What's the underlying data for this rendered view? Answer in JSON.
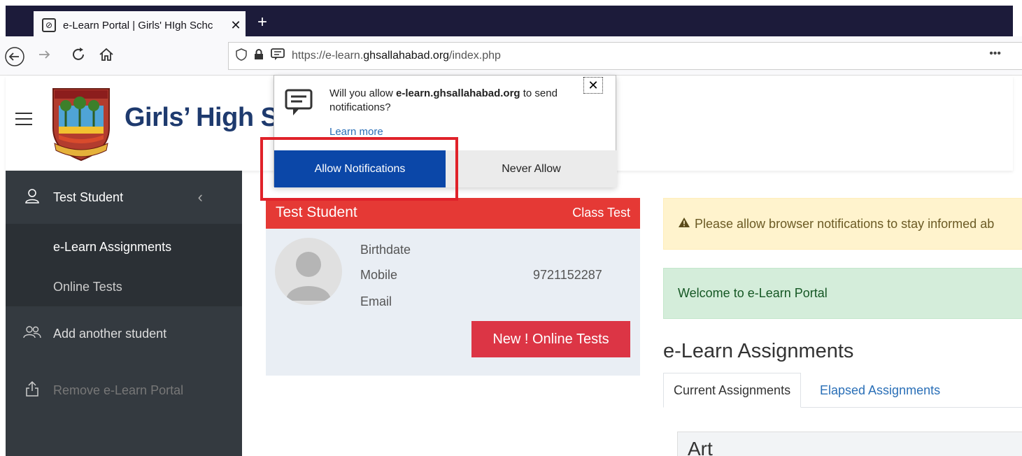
{
  "browser": {
    "tab_title": "e-Learn Portal | Girls' HIgh Schc",
    "url_domain": "https://e-learn.",
    "url_host": "ghsallahabad.org",
    "url_path": "/index.php",
    "new_tab_glyph": "+",
    "more_glyph": "•••"
  },
  "header": {
    "school_name": "Girls’ High Sch"
  },
  "sidebar": {
    "user_name": "Test Student",
    "sub_items": [
      {
        "label": "e-Learn Assignments"
      },
      {
        "label": "Online Tests"
      }
    ],
    "add_student": "Add another student",
    "remove_portal": "Remove e-Learn Portal"
  },
  "profile": {
    "name": "Test Student",
    "badge": "Class Test",
    "fields": [
      {
        "label": "Birthdate",
        "value": ""
      },
      {
        "label": "Mobile",
        "value": "9721152287"
      },
      {
        "label": "Email",
        "value": ""
      }
    ],
    "tests_button": "New ! Online Tests"
  },
  "main": {
    "warning": "Please allow browser notifications to stay informed ab",
    "welcome": "Welcome to e-Learn Portal",
    "section_title": "e-Learn Assignments",
    "tabs": [
      {
        "label": "Current Assignments"
      },
      {
        "label": "Elapsed Assignments"
      }
    ],
    "first_subject": "Art"
  },
  "popup": {
    "question_pre": "Will you allow ",
    "question_host": "e-learn.ghsallahabad.org",
    "question_post": " to send notifications?",
    "learn_more": "Learn more",
    "allow_button": "Allow Notifications",
    "never_button": "Never Allow"
  },
  "colors": {
    "accent_red": "#e53935",
    "allow_blue": "#0b47a8",
    "sidebar_bg": "#343a40"
  }
}
